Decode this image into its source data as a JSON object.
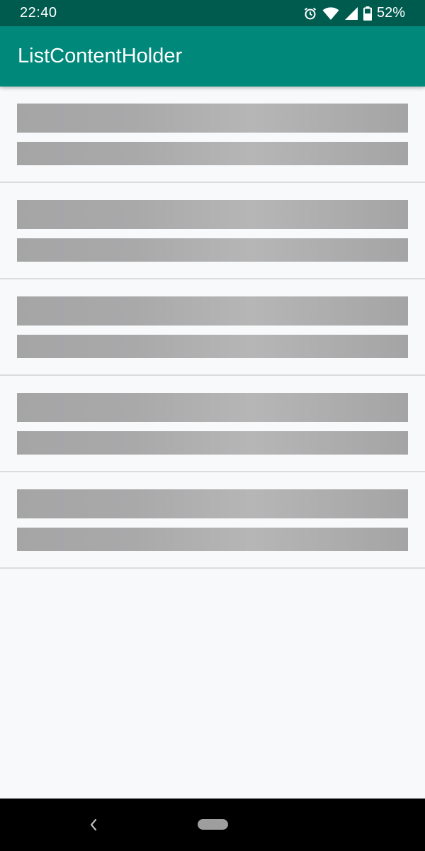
{
  "status_bar": {
    "time": "22:40",
    "battery_percent": "52%",
    "icons": [
      "alarm-icon",
      "wifi-icon",
      "cellular-signal-icon",
      "battery-icon"
    ]
  },
  "app_bar": {
    "title": "ListContentHolder",
    "color": "#00897b"
  },
  "list": {
    "placeholder_item_count": 5,
    "skeleton_color": "#a9a9aa"
  },
  "nav_bar": {
    "icons": [
      "back-icon",
      "home-pill-icon"
    ]
  }
}
